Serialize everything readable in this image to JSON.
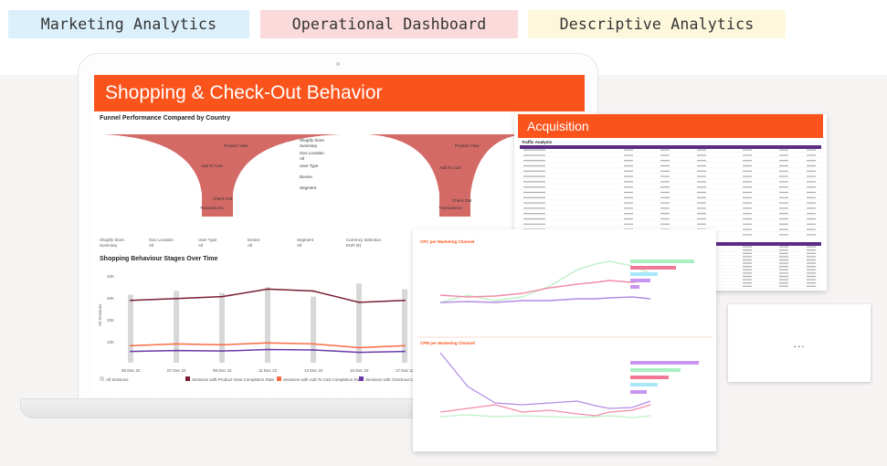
{
  "tags": {
    "marketing": "Marketing Analytics",
    "operational": "Operational Dashboard",
    "descriptive": "Descriptive Analytics"
  },
  "colors": {
    "accent": "#fa541c",
    "tag_blue": "#dcf0fb",
    "tag_red": "#fadada",
    "tag_yellow": "#fdf8dc",
    "funnel": "#cf5a55",
    "purple": "#5b2c86"
  },
  "dashboard": {
    "title": "Shopping & Check-Out Behavior",
    "funnel_title": "Funnel Performance Compared by Country",
    "funnel_labels": {
      "product_view": "Product View",
      "add_to_cart": "Add To Cart",
      "check_out": "Check Out",
      "transactions": "Transactions",
      "shopify_store": "Shopify Store",
      "summary": "Summary",
      "geo_location": "Geo Location",
      "all": "All",
      "user_type": "User Type",
      "device": "Device",
      "segment": "Segment"
    },
    "filters": [
      {
        "label": "Shopify Store",
        "value": "Summary"
      },
      {
        "label": "Geo Location",
        "value": "All"
      },
      {
        "label": "User Type",
        "value": "All"
      },
      {
        "label": "Device",
        "value": "All"
      },
      {
        "label": "Segment",
        "value": "All"
      },
      {
        "label": "Currency Selection",
        "value": "EUR (€)"
      }
    ],
    "stages_title": "Shopping Behaviour Stages Over Time",
    "y_axis_label": "All Sessions",
    "y_ticks": [
      "40K",
      "30K",
      "20K",
      "10K"
    ],
    "x_ticks": [
      "05 Dec 22",
      "07 Dec 22",
      "09 Dec 22",
      "11 Dec 22",
      "13 Dec 22",
      "15 Dec 22",
      "17 Dec 22"
    ],
    "legend": [
      {
        "label": "All Sessions",
        "color": "#d8d8d8"
      },
      {
        "label": "Sessions with Product View Completion Rate",
        "color": "#7a1f33"
      },
      {
        "label": "Sessions with Add To Cart Completion Rate",
        "color": "#fa6b45"
      },
      {
        "label": "Sessions with Checkout Comp",
        "color": "#6a3aa8"
      }
    ]
  },
  "acquisition": {
    "title": "Acquisition",
    "table_title": "Traffic Analysis"
  },
  "marketing": {
    "chart1_title": "CPC per Marketing Channel",
    "chart2_title": "CPM per Marketing Channel"
  },
  "more_panel": {
    "label": "..."
  },
  "chart_data": {
    "type": "line",
    "title": "Shopping Behaviour Stages Over Time",
    "ylabel": "All Sessions",
    "categories": [
      "05 Dec 22",
      "07 Dec 22",
      "09 Dec 22",
      "11 Dec 22",
      "13 Dec 22",
      "15 Dec 22",
      "17 Dec 22"
    ],
    "ylim": [
      0,
      45000
    ],
    "series": [
      {
        "name": "All Sessions",
        "type": "bar",
        "values": [
          36000,
          38000,
          37000,
          40000,
          35000,
          42000,
          39000
        ]
      },
      {
        "name": "Sessions with Product View Completion Rate",
        "values": [
          33000,
          34000,
          35000,
          39000,
          38000,
          32000,
          33000
        ]
      },
      {
        "name": "Sessions with Add To Cart Completion Rate",
        "values": [
          9000,
          10000,
          9500,
          10500,
          10000,
          8000,
          9000
        ]
      },
      {
        "name": "Sessions with Checkout Comp",
        "values": [
          6000,
          6500,
          6200,
          7000,
          6800,
          5500,
          6000
        ]
      }
    ]
  }
}
